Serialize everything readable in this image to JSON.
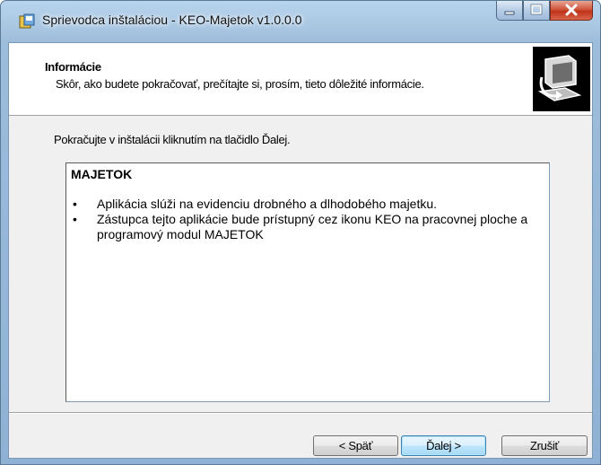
{
  "window": {
    "title": "Sprievodca inštaláciou - KEO-Majetok v1.0.0.0",
    "icon": "installer-icon",
    "caption_buttons": [
      "minimize-icon",
      "maximize-icon",
      "close-icon"
    ]
  },
  "header": {
    "title": "Informácie",
    "subtitle": "Skôr, ako budete pokračovať, prečítajte si, prosím, tieto dôležité informácie.",
    "image": "computer-install-icon"
  },
  "main": {
    "instruction": "Pokračujte v inštalácii kliknutím na tlačidlo Ďalej.",
    "info_title": "MAJETOK",
    "bullets": [
      "Aplikácia slúži na evidenciu drobného a dlhodobého majetku.",
      "Zástupca tejto aplikácie bude prístupný cez ikonu KEO na pracovnej ploche a programový modul MAJETOK"
    ]
  },
  "buttons": {
    "back": "< Späť",
    "next": "Ďalej >",
    "cancel": "Zrušiť"
  }
}
